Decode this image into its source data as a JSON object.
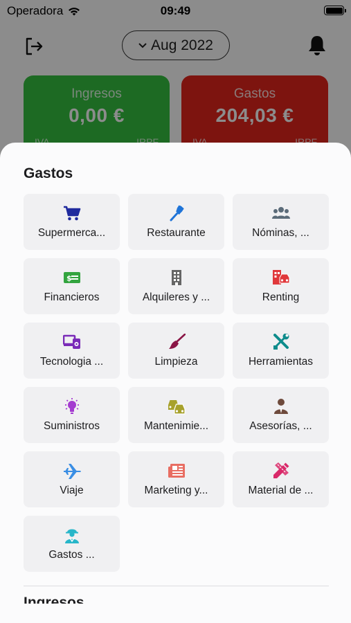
{
  "status_bar": {
    "carrier": "Operadora",
    "time": "09:49"
  },
  "header": {
    "month": "Aug 2022"
  },
  "summary": {
    "income": {
      "title": "Ingresos",
      "amount": "0,00 €",
      "sub_left": "IVA",
      "sub_right": "IRPF"
    },
    "expense": {
      "title": "Gastos",
      "amount": "204,03 €",
      "sub_left": "IVA",
      "sub_right": "IRPF"
    }
  },
  "sheet": {
    "title": "Gastos",
    "next_title": "Ingresos",
    "categories": [
      {
        "label": "Supermerca...",
        "icon": "cart-icon",
        "color": "#1f2a9e"
      },
      {
        "label": "Restaurante",
        "icon": "fork-icon",
        "color": "#1f74d8"
      },
      {
        "label": "Nóminas, ...",
        "icon": "people-icon",
        "color": "#5b6b79"
      },
      {
        "label": "Financieros",
        "icon": "money-icon",
        "color": "#33a43f"
      },
      {
        "label": "Alquileres y ...",
        "icon": "building-icon",
        "color": "#666666"
      },
      {
        "label": "Renting",
        "icon": "car-building-icon",
        "color": "#e0383b"
      },
      {
        "label": "Tecnologia ...",
        "icon": "devices-icon",
        "color": "#7a2bb8"
      },
      {
        "label": "Limpieza",
        "icon": "broom-icon",
        "color": "#8a1646"
      },
      {
        "label": "Herramientas",
        "icon": "tools-icon",
        "color": "#0e8c8c"
      },
      {
        "label": "Suministros",
        "icon": "lightbulb-icon",
        "color": "#a43bd0"
      },
      {
        "label": "Mantenimie...",
        "icon": "cars-icon",
        "color": "#a7a12c"
      },
      {
        "label": "Asesorías, ...",
        "icon": "advisor-icon",
        "color": "#6e4a3c"
      },
      {
        "label": "Viaje",
        "icon": "airplane-icon",
        "color": "#3a8ee4"
      },
      {
        "label": "Marketing y...",
        "icon": "newspaper-icon",
        "color": "#e86d62"
      },
      {
        "label": "Material de ...",
        "icon": "pencil-ruler-icon",
        "color": "#d92a6a"
      },
      {
        "label": "Gastos ...",
        "icon": "worker-icon",
        "color": "#27b6c9"
      }
    ]
  }
}
